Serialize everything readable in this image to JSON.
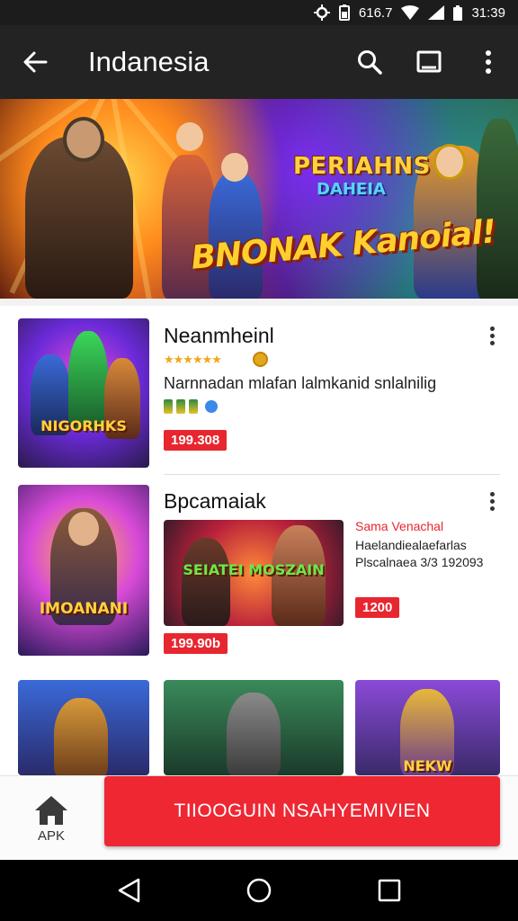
{
  "status_bar": {
    "network_text": "616.7",
    "time": "31:39"
  },
  "app_bar": {
    "title": "Indanesia"
  },
  "banner": {
    "headline_1": "PERIAHNS",
    "headline_2": "DAHEIA",
    "headline_3": "BNONAK Kanoial!"
  },
  "list": {
    "items": [
      {
        "name": "Neanmheinl",
        "description": "Narnnadan mlafan lalmkanid snlalnilig",
        "price": "199.308",
        "thumb_label": "NIGORHKS"
      },
      {
        "name": "Bpcamaiak",
        "price": "199.90b",
        "thumb_label": "IMOANANI",
        "promo": {
          "thumb_label": "SEIATEI MOSZAIN",
          "title": "Sama Venachal",
          "line_1": "Haelandiealaefarlas",
          "line_2": "Plscalnaea 3/3 192093",
          "price": "1200"
        }
      }
    ],
    "partial_row": {
      "thumb_label": "NEKW"
    }
  },
  "bottom_bar": {
    "home_label": "APK",
    "cta_label": "TIIOOGUIN NSAHYEMIVIEN"
  },
  "colors": {
    "accent": "#ee2733",
    "app_bar": "#232323",
    "rating": "#f0a81a"
  },
  "icons": [
    "back-arrow-icon",
    "search-icon",
    "cast-icon",
    "more-vert-icon",
    "home-icon",
    "nav-back-icon",
    "nav-home-icon",
    "nav-recents-icon"
  ]
}
